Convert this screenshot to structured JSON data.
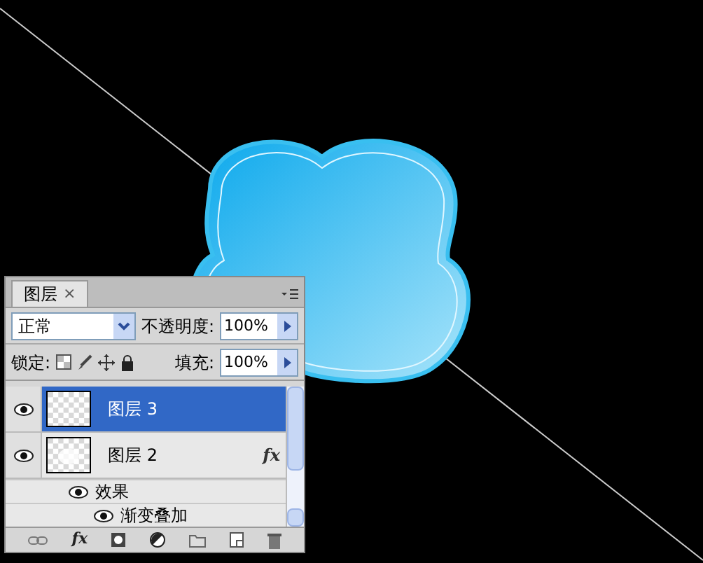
{
  "panel": {
    "tab": {
      "label": "图层",
      "close": "×"
    },
    "blend_mode": {
      "value": "正常"
    },
    "opacity": {
      "label": "不透明度:",
      "value": "100%"
    },
    "lock": {
      "label": "锁定:"
    },
    "fill": {
      "label": "填充:",
      "value": "100%"
    },
    "layers": [
      {
        "name": "图层 3",
        "selected": true,
        "visible": true,
        "fx": false
      },
      {
        "name": "图层 2",
        "selected": false,
        "visible": true,
        "fx": true,
        "fx_label": "fx",
        "children": [
          {
            "name": "效果",
            "visible": true,
            "children": [
              {
                "name": "渐变叠加",
                "visible": true
              }
            ]
          }
        ]
      }
    ],
    "toolbar_fx": "fx"
  }
}
